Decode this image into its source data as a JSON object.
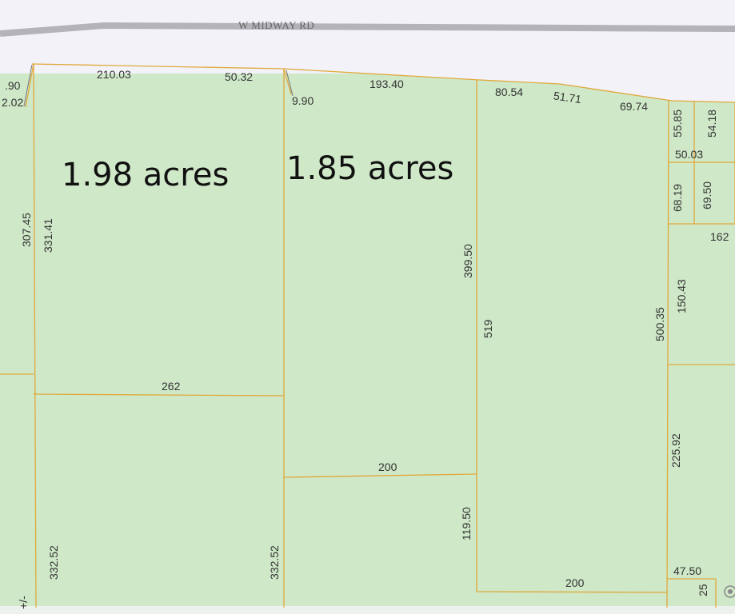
{
  "road": {
    "name": "W MIDWAY RD"
  },
  "parcels": [
    {
      "acres_label": "1.98 acres"
    },
    {
      "acres_label": "1.85 acres"
    }
  ],
  "dimensions": {
    "top_left_a": ".90",
    "top_left_b": "2.02",
    "top_210": "210.03",
    "top_50_32": "50.32",
    "top_9_90": "9.90",
    "top_193": "193.40",
    "top_80": "80.54",
    "top_51": "51.71",
    "top_69_74": "69.74",
    "right_55_85": "55.85",
    "right_54_18": "54.18",
    "right_50_03": "50.03",
    "right_68_19": "68.19",
    "right_69_50": "69.50",
    "right_162": "162",
    "left_307": "307.45",
    "left_331": "331.41",
    "mid_399": "399.50",
    "mid_519": "519",
    "right_500": "500.35",
    "right_150": "150.43",
    "mid_262": "262",
    "mid_200_a": "200",
    "right_225": "225.92",
    "mid_119": "119.50",
    "bottom_332_a": "332.52",
    "bottom_332_b": "332.52",
    "bottom_200": "200",
    "bottom_47": "47.50",
    "bottom_25": "25",
    "bottom_plus": "+/-"
  }
}
